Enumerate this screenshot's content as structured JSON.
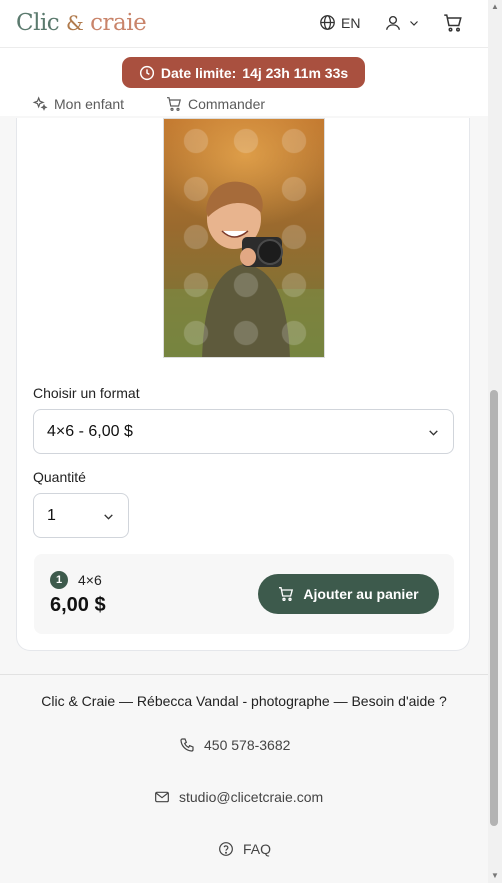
{
  "header": {
    "logo": {
      "part1": "Clic",
      "amp": "&",
      "part2": "craie"
    },
    "language": "EN"
  },
  "deadline": {
    "label": "Date limite:",
    "countdown": "14j 23h 11m 33s"
  },
  "nav": {
    "child_label": "Mon enfant",
    "order_label": "Commander"
  },
  "product": {
    "format_label": "Choisir un format",
    "format_value": "4×6 - 6,00 $",
    "quantity_label": "Quantité",
    "quantity_value": "1"
  },
  "summary": {
    "count": "1",
    "format": "4×6",
    "price": "6,00 $",
    "add_button": "Ajouter au panier"
  },
  "footer": {
    "credit": "Clic & Craie — Rébecca Vandal - photographe — Besoin d'aide ?",
    "phone": "450 578-3682",
    "email": "studio@clicetcraie.com",
    "faq": "FAQ"
  },
  "colors": {
    "accent_green": "#3d5a4c",
    "deadline_red": "#a9503f",
    "logo_green": "#5b7a6e",
    "logo_peach": "#c9846a"
  }
}
